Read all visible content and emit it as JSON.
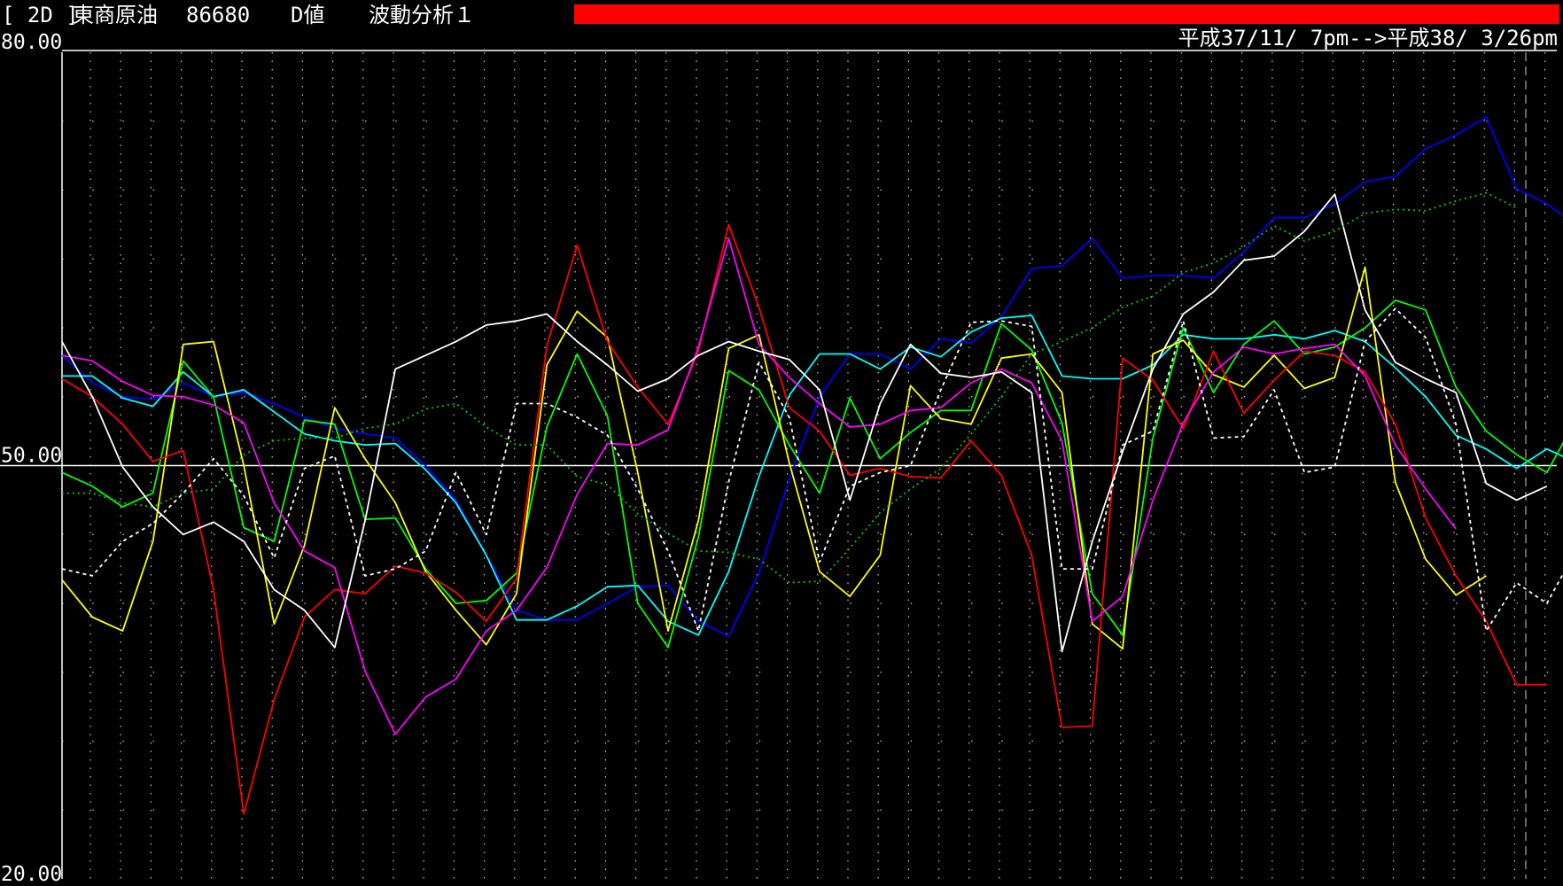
{
  "header": {
    "tag": "[ 2D ]",
    "name": "東商原油",
    "code": "86680",
    "value_type": "D値",
    "analysis": "波動分析１",
    "date_range": "平成37/11/ 7pm-->平成38/ 3/26pm"
  },
  "colors": {
    "background": "#000000",
    "red_bar": "#ff0000",
    "grid": "#c8c8c8",
    "midline": "#ffffff"
  },
  "chart_data": {
    "type": "line",
    "ylim": [
      20,
      80
    ],
    "ytick_labels": [
      "80.00",
      "50.00",
      "20.00"
    ],
    "midline": 50,
    "x": [
      1,
      2,
      3,
      4,
      5,
      6,
      7,
      8,
      9,
      10,
      11,
      12,
      13,
      14,
      15,
      16,
      17,
      18,
      19,
      20,
      21,
      22,
      23,
      24,
      25,
      26,
      27,
      28,
      29,
      30,
      31,
      32,
      33,
      34,
      35,
      36,
      37,
      38,
      39,
      40,
      41,
      42,
      43,
      44,
      45,
      46,
      47,
      48,
      49,
      50,
      51
    ],
    "series": [
      {
        "color": "#0000ff",
        "dash": "solid",
        "values": [
          58,
          56,
          55,
          54.8,
          56,
          55,
          55.3,
          54.5,
          53.5,
          52.7,
          52.3,
          52,
          50,
          47.5,
          43.5,
          39.5,
          38.8,
          38.8,
          40,
          41.2,
          41.3,
          38.7,
          37.6,
          42.2,
          49,
          55,
          58.1,
          58.1,
          57,
          59.2,
          58.9,
          60.8,
          64.3,
          64.5,
          66.5,
          63.6,
          63.8,
          63.8,
          63.6,
          65.5,
          68,
          68,
          69,
          70.6,
          71,
          73,
          74,
          75.3,
          70.1,
          69,
          67.4
        ]
      },
      {
        "color": "#00ffff",
        "dash": "solid",
        "values": [
          56.5,
          56.5,
          54.9,
          54.3,
          56.8,
          55,
          55.5,
          53.9,
          52.3,
          51.8,
          51.5,
          51.6,
          49.7,
          47.3,
          43.5,
          38.8,
          38.8,
          39.8,
          41.2,
          41.3,
          38.7,
          37.7,
          42.3,
          49.2,
          55.1,
          58.1,
          58.1,
          57,
          58.6,
          57.9,
          59.7,
          60.7,
          60.9,
          56.5,
          56.3,
          56.3,
          57.3,
          59.5,
          59.2,
          59.2,
          59.5,
          59.2,
          59.8,
          59,
          57.1,
          55,
          52.2,
          51.2,
          49.8,
          51.2,
          50.2
        ]
      },
      {
        "color": "#00ff00",
        "dash": "solid",
        "values": [
          49.5,
          48.5,
          47,
          48,
          57.6,
          55,
          45.5,
          44.5,
          53.3,
          53,
          46.1,
          46.2,
          42.5,
          40,
          40.2,
          42.2,
          52.8,
          58.1,
          53.6,
          40,
          36.8,
          44.8,
          56.9,
          55.5,
          51.5,
          48,
          54.9,
          50.5,
          52.4,
          54,
          54,
          60.3,
          58.4,
          53.1,
          40.7,
          37.7,
          52,
          60,
          55.3,
          58.8,
          60.5,
          58.1,
          58.6,
          60,
          62,
          61.3,
          55.7,
          52.5,
          50.8,
          49.5,
          53.5
        ]
      },
      {
        "color": "#ffff00",
        "dash": "solid",
        "values": [
          41.7,
          39,
          38,
          44.5,
          58.8,
          59,
          50,
          38.5,
          44.2,
          54.2,
          50.5,
          47.3,
          42.3,
          39.5,
          37,
          40.7,
          57.3,
          61.2,
          59.3,
          49.5,
          38,
          46,
          58.5,
          59.5,
          50.2,
          42.3,
          40.5,
          43.5,
          55.8,
          53.4,
          53,
          57.8,
          58.1,
          55.3,
          38.5,
          36.7,
          58.1,
          59.1,
          56.6,
          55.7,
          58,
          55.6,
          56.4,
          64.4,
          48.8,
          43.2,
          40.6,
          42
        ]
      },
      {
        "color": "#ff0000",
        "dash": "solid",
        "values": [
          56.3,
          55,
          53,
          50.3,
          51.1,
          41,
          24.7,
          33,
          39,
          41,
          40.7,
          42.7,
          42.2,
          40.8,
          38.7,
          41.8,
          58.7,
          66,
          59,
          55.7,
          53,
          58.3,
          67.5,
          61.5,
          54.2,
          52.5,
          49.3,
          49.8,
          49.2,
          49.1,
          51.8,
          49.3,
          43.5,
          31,
          31.1,
          57.8,
          56.2,
          52.7,
          58.3,
          53.8,
          56.2,
          58.3,
          58,
          56.8,
          53,
          46.2,
          42,
          38.7,
          34.1,
          34.1
        ]
      },
      {
        "color": "#ff00ff",
        "dash": "solid",
        "values": [
          58,
          57.6,
          56.1,
          55.1,
          55,
          54.4,
          53.1,
          47.3,
          43.8,
          42.6,
          35.1,
          30.5,
          33.2,
          34.5,
          38,
          39.5,
          42.6,
          47.9,
          51.6,
          51.5,
          52.6,
          58.6,
          66.5,
          58.8,
          56.4,
          54.5,
          52.8,
          53,
          54,
          54.2,
          56,
          57,
          56,
          51.8,
          38.7,
          40.5,
          47.5,
          53.1,
          56.8,
          58.6,
          58.1,
          58.5,
          58.8,
          56.5,
          51.5,
          48.3,
          45.4
        ]
      },
      {
        "color": "#ffffff",
        "dash": "solid",
        "values": [
          59,
          55,
          49.9,
          47,
          45,
          45.9,
          44.5,
          41,
          39.5,
          36.8,
          46,
          57,
          58,
          59,
          60.2,
          60.5,
          61,
          59,
          57.3,
          55.4,
          56.3,
          58,
          59,
          58.3,
          57.7,
          55.5,
          47.5,
          54.5,
          58.8,
          56.7,
          56.4,
          56.8,
          55.3,
          36.5,
          44.5,
          51,
          57,
          61,
          62.6,
          64.9,
          65.2,
          67,
          69.7,
          61.3,
          57.5,
          56.3,
          55.3,
          48.7,
          47.5,
          48.5
        ]
      },
      {
        "color": "#ffffff",
        "dash": "dash",
        "values": [
          42.5,
          42,
          44.5,
          45.8,
          48,
          50.5,
          47.8,
          43.3,
          49.8,
          50.7,
          42,
          42.5,
          43.8,
          49.5,
          45,
          54.5,
          54.5,
          53.5,
          52.2,
          48.3,
          43.8,
          38,
          48.8,
          57.5,
          53.5,
          43,
          48.5,
          49.5,
          50,
          55.5,
          60.4,
          60.5,
          60.1,
          42.5,
          42.5,
          51.5,
          52.5,
          60.5,
          52,
          52.1,
          55.5,
          49.5,
          49.9,
          59,
          61.4,
          59.3,
          53,
          38,
          41.5,
          40,
          44
        ]
      },
      {
        "color": "#00cc00",
        "dash": "dot",
        "values": [
          48,
          48,
          47.3,
          47,
          48,
          48.3,
          50.8,
          51.8,
          52,
          52,
          52.7,
          53,
          54.1,
          54.5,
          52.8,
          51.5,
          51.5,
          49.2,
          48.6,
          46.5,
          45.1,
          43.8,
          43.7,
          43.2,
          41.5,
          41.6,
          44,
          46.6,
          48.3,
          49.8,
          52.3,
          55,
          58.1,
          59,
          60,
          61.5,
          62.3,
          64,
          64.7,
          65.9,
          67.4,
          66.3,
          67,
          68.3,
          68.6,
          68.5,
          69.2,
          69.8,
          68.7
        ]
      }
    ]
  }
}
